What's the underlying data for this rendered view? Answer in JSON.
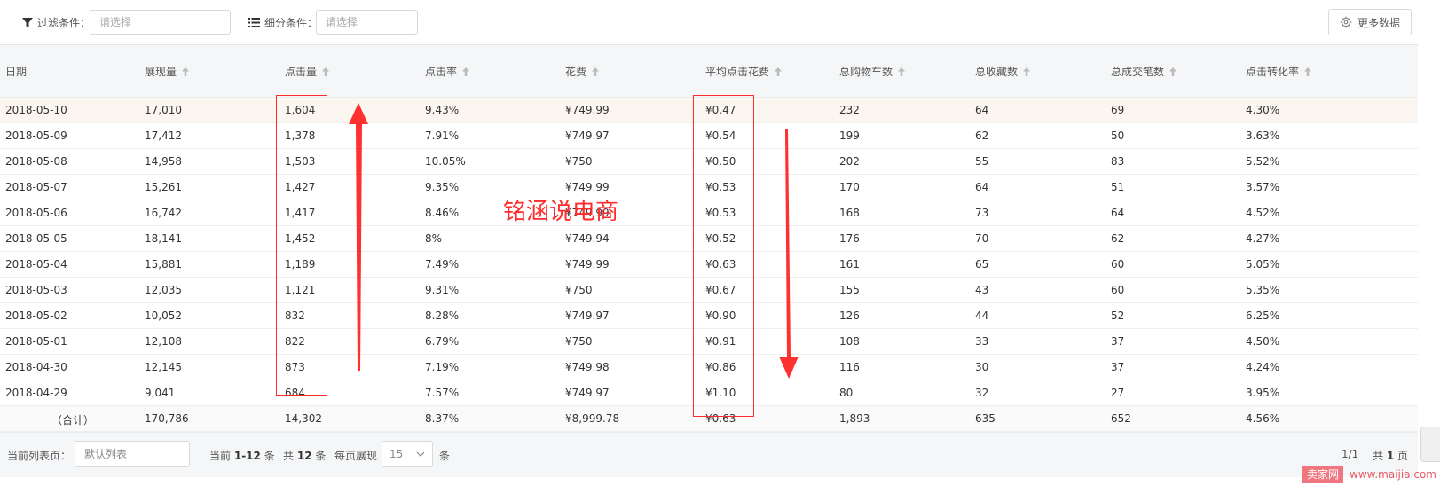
{
  "filter": {
    "filter_label": "过滤条件：",
    "filter_placeholder": "请选择",
    "segment_label": "细分条件：",
    "segment_placeholder": "请选择",
    "more_data_label": "更多数据"
  },
  "table": {
    "columns": [
      "日期",
      "展现量",
      "点击量",
      "点击率",
      "花费",
      "平均点击花费",
      "总购物车数",
      "总收藏数",
      "总成交笔数",
      "点击转化率"
    ],
    "rows": [
      [
        "2018-05-10",
        "17,010",
        "1,604",
        "9.43%",
        "¥749.99",
        "¥0.47",
        "232",
        "64",
        "69",
        "4.30%"
      ],
      [
        "2018-05-09",
        "17,412",
        "1,378",
        "7.91%",
        "¥749.97",
        "¥0.54",
        "199",
        "62",
        "50",
        "3.63%"
      ],
      [
        "2018-05-08",
        "14,958",
        "1,503",
        "10.05%",
        "¥750",
        "¥0.50",
        "202",
        "55",
        "83",
        "5.52%"
      ],
      [
        "2018-05-07",
        "15,261",
        "1,427",
        "9.35%",
        "¥749.99",
        "¥0.53",
        "170",
        "64",
        "51",
        "3.57%"
      ],
      [
        "2018-05-06",
        "16,742",
        "1,417",
        "8.46%",
        "¥749.99",
        "¥0.53",
        "168",
        "73",
        "64",
        "4.52%"
      ],
      [
        "2018-05-05",
        "18,141",
        "1,452",
        "8%",
        "¥749.94",
        "¥0.52",
        "176",
        "70",
        "62",
        "4.27%"
      ],
      [
        "2018-05-04",
        "15,881",
        "1,189",
        "7.49%",
        "¥749.99",
        "¥0.63",
        "161",
        "65",
        "60",
        "5.05%"
      ],
      [
        "2018-05-03",
        "12,035",
        "1,121",
        "9.31%",
        "¥750",
        "¥0.67",
        "155",
        "43",
        "60",
        "5.35%"
      ],
      [
        "2018-05-02",
        "10,052",
        "832",
        "8.28%",
        "¥749.97",
        "¥0.90",
        "126",
        "44",
        "52",
        "6.25%"
      ],
      [
        "2018-05-01",
        "12,108",
        "822",
        "6.79%",
        "¥750",
        "¥0.91",
        "108",
        "33",
        "37",
        "4.50%"
      ],
      [
        "2018-04-30",
        "12,145",
        "873",
        "7.19%",
        "¥749.98",
        "¥0.86",
        "116",
        "30",
        "37",
        "4.24%"
      ],
      [
        "2018-04-29",
        "9,041",
        "684",
        "7.57%",
        "¥749.97",
        "¥1.10",
        "80",
        "32",
        "27",
        "3.95%"
      ]
    ],
    "total": [
      "（合计）",
      "170,786",
      "14,302",
      "8.37%",
      "¥8,999.78",
      "¥0.63",
      "1,893",
      "635",
      "652",
      "4.56%"
    ]
  },
  "footer": {
    "current_list_label": "当前列表页：",
    "current_list_value": "默认列表",
    "range_prefix": "当前",
    "range_value": "1-12",
    "range_suffix": "条",
    "total_prefix": "共",
    "total_value": "12",
    "total_suffix": "条",
    "per_page_label": "每页展现",
    "per_page_value": "15",
    "per_page_suffix": "条",
    "page_indicator": "1/1",
    "pages_prefix": "共",
    "pages_value": "1",
    "pages_suffix": "页"
  },
  "watermark": "铭涵说电商",
  "branding": {
    "badge": "卖家网",
    "url": "www.maijia.com"
  },
  "colors": {
    "annotation": "#ff2a2a",
    "highlight_row": "#fcf6f1",
    "header_bg": "#f5f6f7"
  },
  "icons": {
    "filter": "funnel-icon",
    "segment": "list-icon",
    "more_data": "gear-icon",
    "sort": "sort-up-icon",
    "dropdown": "chevron-down-icon"
  }
}
